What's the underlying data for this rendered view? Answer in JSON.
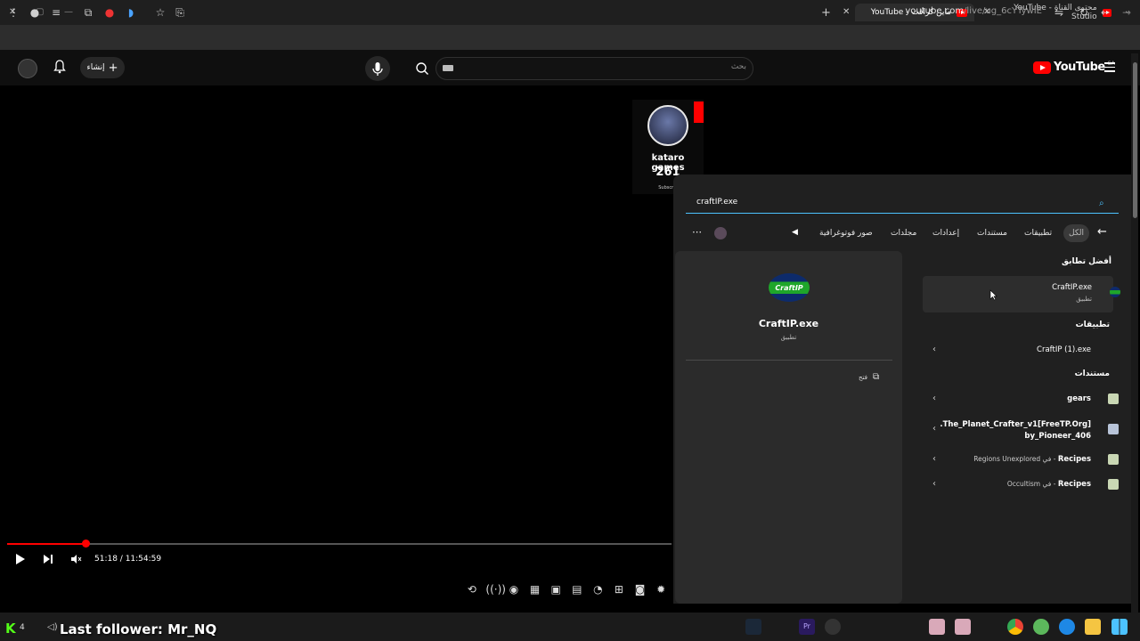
{
  "browser": {
    "tabs": [
      {
        "title": "محتوى القناة - YouTube Studio",
        "active": false
      },
      {
        "title": "ماين كرافت - YouTube",
        "active": true
      }
    ],
    "url_domain": "youtube.com",
    "url_path": "/live/ug_6cYTywIE"
  },
  "youtube": {
    "search_placeholder": "بحث",
    "create_label": "إنشاء",
    "logo_text": "YouTube",
    "logo_region": "SA"
  },
  "channel_card": {
    "name": "kataro games",
    "subscribers": "261",
    "subscribe_label": "Subscrib"
  },
  "player": {
    "time": "51:18 / 11:54:59",
    "progress": 0.118
  },
  "windows_search": {
    "query": "craftIP.exe",
    "filters": [
      "الكل",
      "تطبيقات",
      "مستندات",
      "إعدادات",
      "مجلدات",
      "صور فوتوغرافية"
    ],
    "best_match_heading": "أفضل تطابق",
    "best_match": {
      "name": "CraftIP.exe",
      "type": "تطبيق"
    },
    "apps_heading": "تطبيقات",
    "apps": [
      "CraftIP (1).exe"
    ],
    "docs_heading": "مستندات",
    "documents": [
      {
        "name": "gears",
        "suffix": ""
      },
      {
        "name": "[FreeTP.Org]The_Planet_Crafter_v1.",
        "line2": "406_by_Pioneer",
        "suffix": ""
      },
      {
        "name": "Recipes",
        "suffix": " - في Regions Unexplored"
      },
      {
        "name": "Recipes",
        "suffix": " - في Occultism"
      }
    ],
    "preview": {
      "logo_text": "CraftIP",
      "name": "CraftIP.exe",
      "type": "تطبيق",
      "open_label": "فتح"
    }
  },
  "overlay": {
    "follower_text": "Last follower: Mr_NQ",
    "kick_count": "4"
  }
}
